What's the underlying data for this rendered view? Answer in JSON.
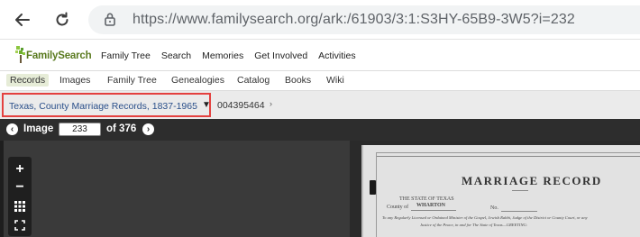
{
  "browser": {
    "url": "https://www.familysearch.org/ark:/61903/3:1:S3HY-65B9-3W5?i=232"
  },
  "site": {
    "logo_text": "FamilySearch",
    "top_nav": [
      "Family Tree",
      "Search",
      "Memories",
      "Get Involved",
      "Activities"
    ],
    "sub_nav": [
      "Records",
      "Images",
      "Family Tree",
      "Genealogies",
      "Catalog",
      "Books",
      "Wiki"
    ],
    "sub_nav_active": "Records"
  },
  "breadcrumb": {
    "collection": "Texas, County Marriage Records, 1837-1965",
    "film_number": "004395464"
  },
  "image_nav": {
    "label": "Image",
    "current": "233",
    "of_text": "of 376"
  },
  "document": {
    "title": "MARRIAGE RECORD",
    "state_line": "THE STATE OF TEXAS",
    "county_label": "County of",
    "county_value": "WHARTON",
    "no_label": "No.",
    "body_line1": "To any Regularly Licensed or Ordained Minister of the Gospel, Jewish Rabbi, Judge of the District or County Court, or any",
    "body_line2": "Justice of the Peace, in and for The State of Texas—GREETING:"
  },
  "colors": {
    "highlight_border": "#e4413f",
    "link_blue": "#2a4f8a",
    "brand_green": "#5a7a1f"
  }
}
